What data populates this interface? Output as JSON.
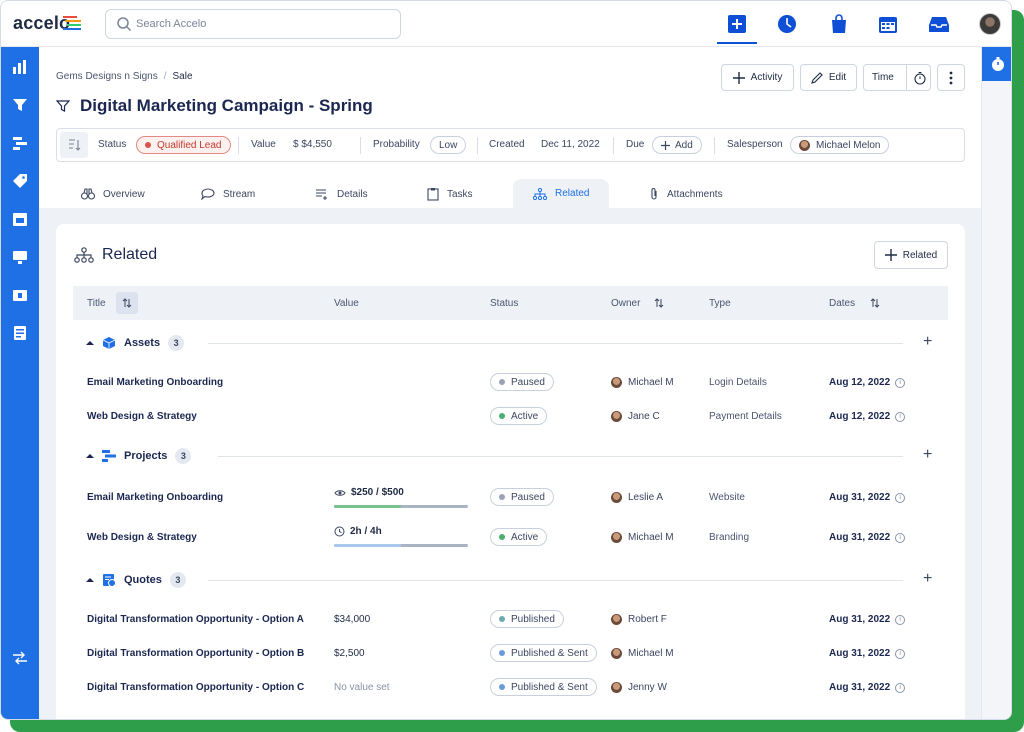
{
  "brand": "accelo",
  "search": {
    "placeholder": "Search Accelo"
  },
  "breadcrumb": {
    "parent": "Gems Designs n Signs",
    "current": "Sale"
  },
  "title": "Digital Marketing Campaign - Spring",
  "header_buttons": {
    "activity": "Activity",
    "edit": "Edit",
    "time": "Time"
  },
  "infobar": {
    "status_label": "Status",
    "status_value": "Qualified Lead",
    "value_label": "Value",
    "value_value": "$ $4,550",
    "probability_label": "Probability",
    "probability_value": "Low",
    "created_label": "Created",
    "created_value": "Dec 11, 2022",
    "due_label": "Due",
    "due_add": "Add",
    "salesperson_label": "Salesperson",
    "salesperson_value": "Michael Melon"
  },
  "tabs": [
    "Overview",
    "Stream",
    "Details",
    "Tasks",
    "Related",
    "Attachments"
  ],
  "related": {
    "heading": "Related",
    "add_button": "Related",
    "columns": {
      "title": "Title",
      "value": "Value",
      "status": "Status",
      "owner": "Owner",
      "type": "Type",
      "dates": "Dates"
    },
    "groups": {
      "assets": {
        "name": "Assets",
        "count": "3",
        "rows": [
          {
            "title": "Email Marketing Onboarding",
            "status": "Paused",
            "owner": "Michael M",
            "type": "Login Details",
            "date": "Aug 12, 2022"
          },
          {
            "title": "Web Design & Strategy",
            "status": "Active",
            "owner": "Jane C",
            "type": "Payment Details",
            "date": "Aug 12, 2022"
          }
        ]
      },
      "projects": {
        "name": "Projects",
        "count": "3",
        "rows": [
          {
            "title": "Email Marketing Onboarding",
            "value": "$250 / $500",
            "progress": 0.5,
            "status": "Paused",
            "owner": "Leslie A",
            "type": "Website",
            "date": "Aug 31, 2022"
          },
          {
            "title": "Web Design & Strategy",
            "value": "2h / 4h",
            "progress": 0.5,
            "status": "Active",
            "owner": "Michael M",
            "type": "Branding",
            "date": "Aug 31, 2022"
          }
        ]
      },
      "quotes": {
        "name": "Quotes",
        "count": "3",
        "rows": [
          {
            "title": "Digital Transformation Opportunity - Option A",
            "value": "$34,000",
            "status": "Published",
            "owner": "Robert F",
            "date": "Aug 31, 2022"
          },
          {
            "title": "Digital Transformation Opportunity - Option B",
            "value": "$2,500",
            "status": "Published & Sent",
            "owner": "Michael M",
            "date": "Aug 31, 2022"
          },
          {
            "title": "Digital Transformation Opportunity - Option C",
            "value": "No value set",
            "status": "Published & Sent",
            "owner": "Jenny W",
            "date": "Aug 31, 2022"
          }
        ]
      }
    }
  },
  "colors": {
    "accent": "#1f6fe5",
    "paused": "#9aa3b5",
    "active": "#4caf6e",
    "published": "#6a9bd8",
    "qualified": "#d9534f"
  }
}
